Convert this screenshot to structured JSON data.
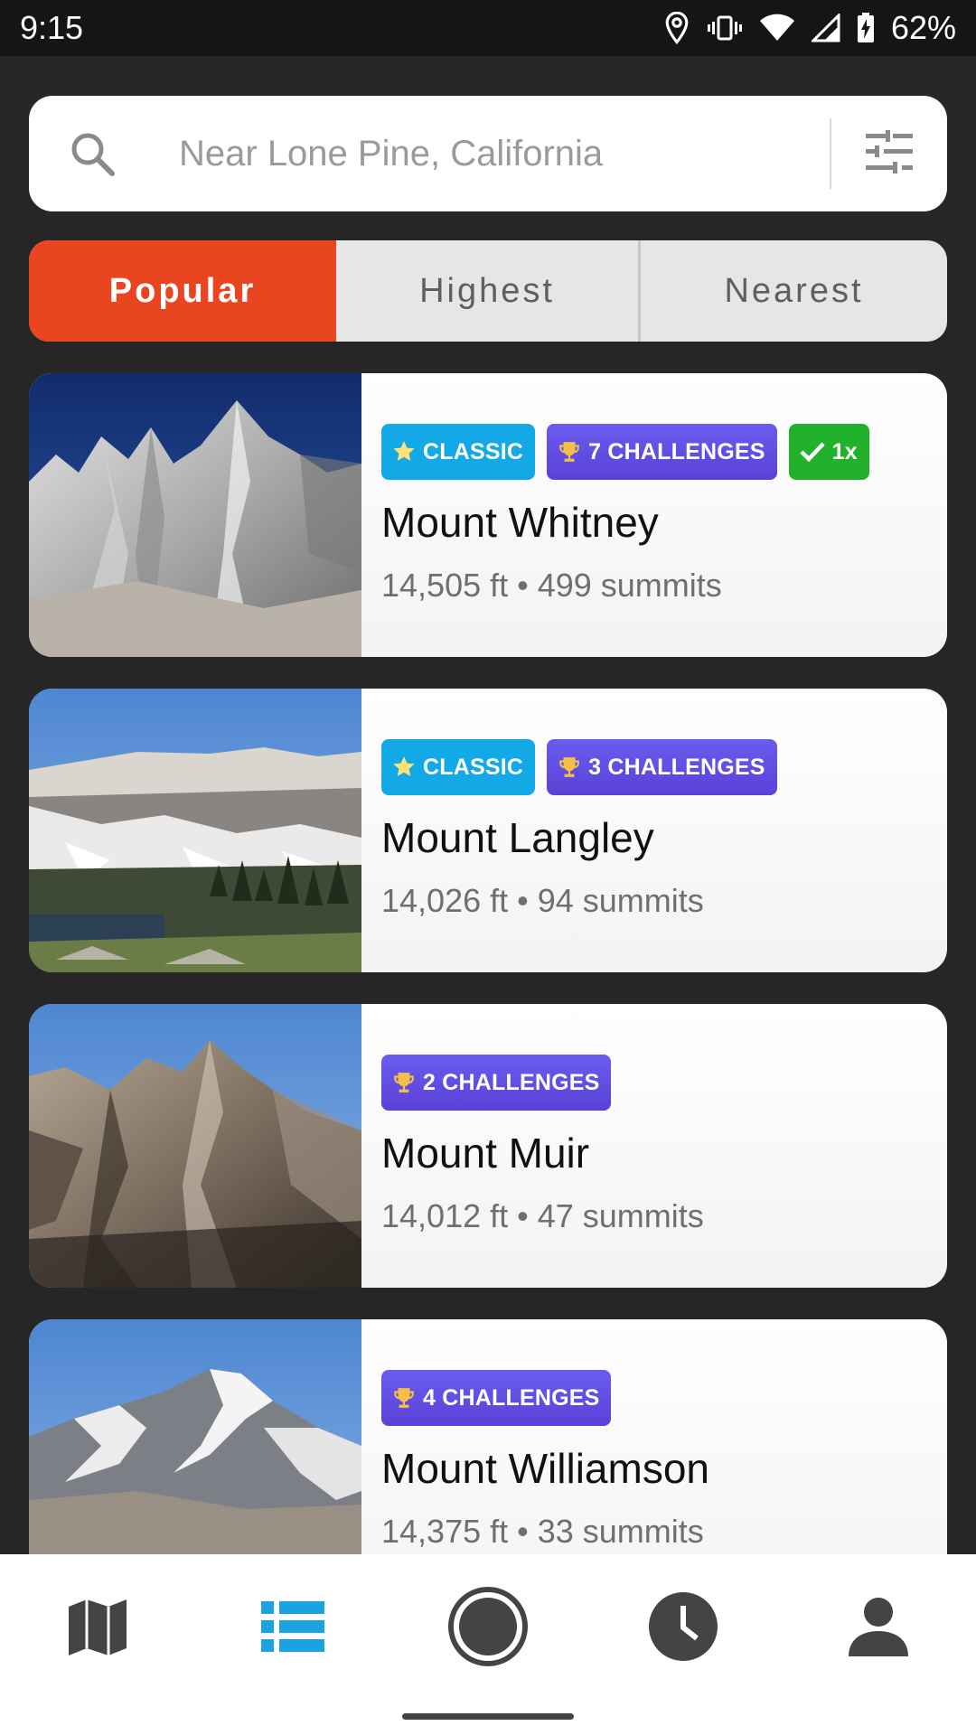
{
  "status_bar": {
    "time": "9:15",
    "battery": "62%",
    "icons": [
      "location-icon",
      "vibrate-icon",
      "wifi-icon",
      "signal-icon",
      "battery-charging-icon"
    ]
  },
  "search": {
    "placeholder": "Near Lone Pine, California",
    "icon": "search-icon",
    "filter_icon": "tune-icon"
  },
  "tabs": [
    {
      "label": "Popular",
      "active": true
    },
    {
      "label": "Highest",
      "active": false
    },
    {
      "label": "Nearest",
      "active": false
    }
  ],
  "peaks": [
    {
      "name": "Mount Whitney",
      "meta": "14,505 ft • 499 summits",
      "badges": {
        "classic": "CLASSIC",
        "challenges": "7 CHALLENGES",
        "done": "1x"
      }
    },
    {
      "name": "Mount Langley",
      "meta": "14,026 ft • 94 summits",
      "badges": {
        "classic": "CLASSIC",
        "challenges": "3 CHALLENGES"
      }
    },
    {
      "name": "Mount Muir",
      "meta": "14,012 ft • 47 summits",
      "badges": {
        "challenges": "2 CHALLENGES"
      }
    },
    {
      "name": "Mount Williamson",
      "meta": "14,375 ft • 33 summits",
      "badges": {
        "challenges": "4 CHALLENGES"
      }
    }
  ],
  "colors": {
    "accent": "#ea4521",
    "classic_badge": "#12a9e6",
    "challenge_badge": "#5b47e0",
    "done_badge": "#22b12b",
    "nav_active": "#1aa3e0",
    "nav_inactive": "#444444"
  },
  "bottom_nav": [
    {
      "icon": "map-icon",
      "active": false
    },
    {
      "icon": "list-icon",
      "active": true
    },
    {
      "icon": "record-icon",
      "active": false
    },
    {
      "icon": "history-clock-icon",
      "active": false
    },
    {
      "icon": "profile-icon",
      "active": false
    }
  ]
}
